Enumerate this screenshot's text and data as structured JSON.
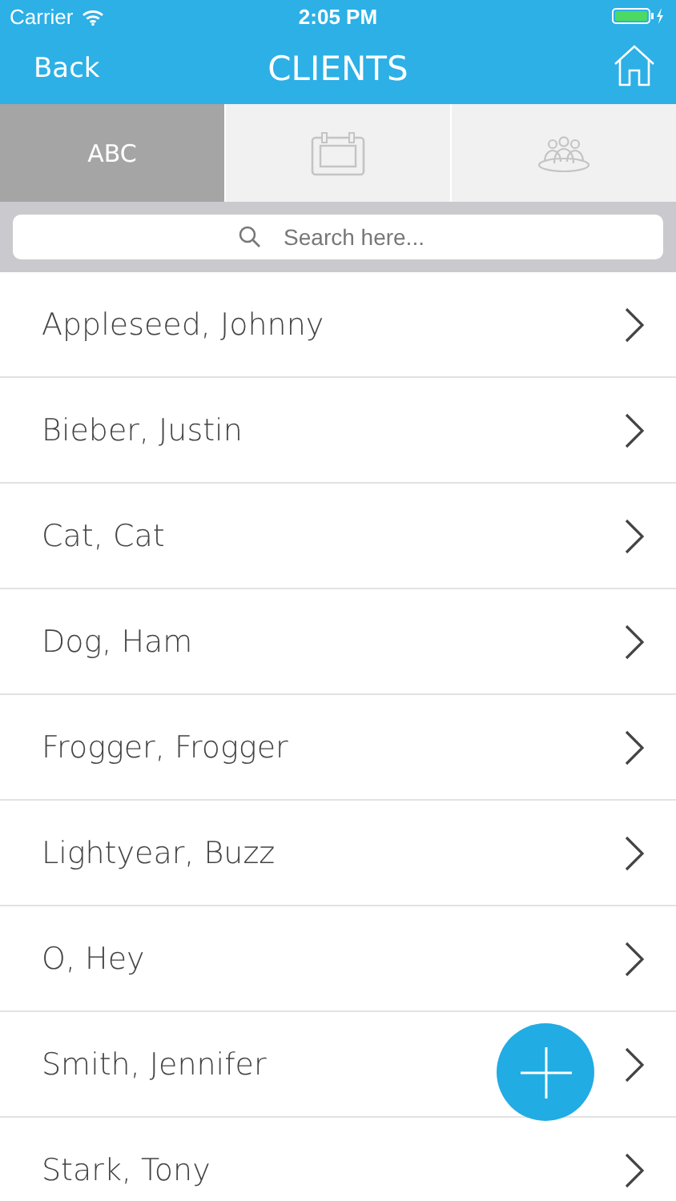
{
  "status_bar": {
    "carrier": "Carrier",
    "time": "2:05 PM"
  },
  "nav": {
    "back": "Back",
    "title": "CLIENTS"
  },
  "tabs": [
    {
      "kind": "text",
      "label": "ABC",
      "selected": true
    },
    {
      "kind": "calendar",
      "selected": false
    },
    {
      "kind": "people",
      "selected": false
    }
  ],
  "search": {
    "placeholder": "Search here..."
  },
  "clients": [
    {
      "name": "Appleseed, Johnny"
    },
    {
      "name": "Bieber, Justin"
    },
    {
      "name": "Cat, Cat"
    },
    {
      "name": "Dog, Ham"
    },
    {
      "name": "Frogger, Frogger"
    },
    {
      "name": "Lightyear, Buzz"
    },
    {
      "name": "O, Hey"
    },
    {
      "name": "Smith, Jennifer"
    },
    {
      "name": "Stark, Tony"
    }
  ]
}
